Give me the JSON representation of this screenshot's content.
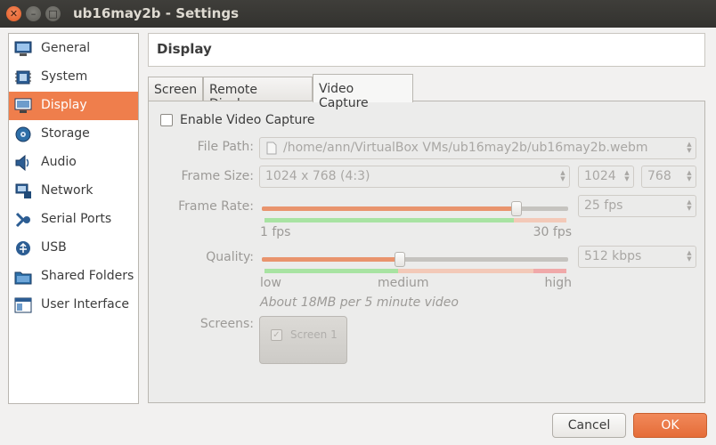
{
  "window": {
    "title": "ub16may2b - Settings"
  },
  "sidebar": {
    "items": [
      {
        "label": "General",
        "icon": "monitor-general-icon"
      },
      {
        "label": "System",
        "icon": "chip-icon"
      },
      {
        "label": "Display",
        "icon": "display-icon",
        "active": true
      },
      {
        "label": "Storage",
        "icon": "disk-icon"
      },
      {
        "label": "Audio",
        "icon": "speaker-icon"
      },
      {
        "label": "Network",
        "icon": "network-icon"
      },
      {
        "label": "Serial Ports",
        "icon": "serial-port-icon"
      },
      {
        "label": "USB",
        "icon": "usb-icon"
      },
      {
        "label": "Shared Folders",
        "icon": "folder-icon"
      },
      {
        "label": "User Interface",
        "icon": "window-icon"
      }
    ]
  },
  "header": {
    "title": "Display"
  },
  "tabs": [
    {
      "label": "Screen"
    },
    {
      "label": "Remote Display"
    },
    {
      "label": "Video Capture",
      "active": true
    }
  ],
  "video_capture": {
    "enable_label": "Enable Video Capture",
    "enabled": false,
    "file_path_label": "File Path:",
    "file_path_value": "/home/ann/VirtualBox VMs/ub16may2b/ub16may2b.webm",
    "frame_size_label": "Frame Size:",
    "frame_size_value": "1024 x 768 (4:3)",
    "frame_width": "1024",
    "frame_height": "768",
    "frame_rate_label": "Frame Rate:",
    "frame_rate_value": "25 fps",
    "frame_rate_fraction": 0.83,
    "frame_rate_min": "1 fps",
    "frame_rate_max": "30 fps",
    "quality_label": "Quality:",
    "quality_value": "512 kbps",
    "quality_fraction": 0.45,
    "quality_low": "low",
    "quality_medium": "medium",
    "quality_high": "high",
    "estimate_text": "About 18MB per 5 minute video",
    "screens_label": "Screens:",
    "screen_items": [
      {
        "label": "Screen 1",
        "checked": true
      }
    ]
  },
  "buttons": {
    "cancel": "Cancel",
    "ok": "OK"
  },
  "colors": {
    "accent": "#ef7e4c",
    "ok_button": "#e8743e",
    "title_bar": "#3c3b37",
    "slider_fill": "#e9946d",
    "zone_green": "#a8e3a2",
    "zone_orange": "#f3c9b8",
    "zone_red": "#f0a9a9"
  }
}
